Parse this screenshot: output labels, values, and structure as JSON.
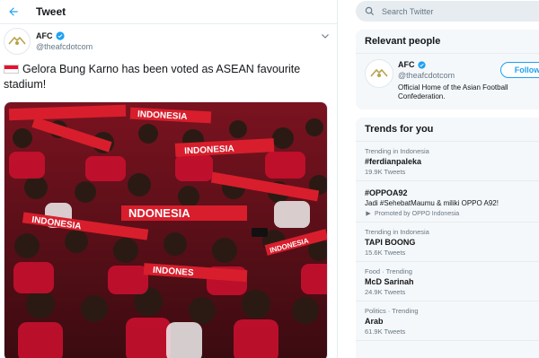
{
  "header": {
    "title": "Tweet"
  },
  "tweet": {
    "author_name": "AFC",
    "author_handle": "@theafcdotcom",
    "text": "Gelora Bung Karno has been voted as ASEAN favourite stadium!",
    "photo_banners": [
      "INDONESIA",
      "INDONESIA",
      "INDONESIA",
      "NDONESIA",
      "INDONES",
      "INDONESIA"
    ]
  },
  "search": {
    "placeholder": "Search Twitter"
  },
  "relevant_people": {
    "title": "Relevant people",
    "name": "AFC",
    "handle": "@theafcdotcom",
    "follow_label": "Follow",
    "bio": "Official Home of the Asian Football Confederation."
  },
  "trends": {
    "title": "Trends for you",
    "items": [
      {
        "context": "Trending in Indonesia",
        "name": "#ferdianpaleka",
        "count": "19.9K Tweets"
      },
      {
        "context": "",
        "name": "#OPPOA92",
        "description": "Jadi #SehebatMaumu & miliki OPPO A92!",
        "promoted": "Promoted by OPPO Indonesia"
      },
      {
        "context": "Trending in Indonesia",
        "name": "TAPI BOONG",
        "count": "15.6K Tweets"
      },
      {
        "context": "Food · Trending",
        "name": "McD Sarinah",
        "count": "24.9K Tweets"
      },
      {
        "context": "Politics · Trending",
        "name": "Arab",
        "count": "61.9K Tweets"
      }
    ]
  },
  "colors": {
    "accent": "#1da1f2",
    "verified": "#1da1f2",
    "crowd_red": "#c8102e"
  }
}
